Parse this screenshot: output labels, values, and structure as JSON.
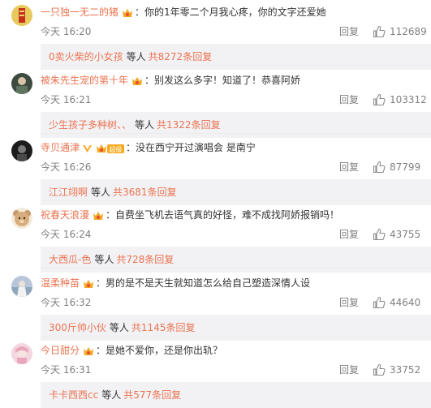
{
  "comments": [
    {
      "username": "一只独一无二的猪",
      "text": "你的1年零二个月我心疼，你的文字还爱她",
      "time": "今天 16:20",
      "reply_label": "回复",
      "likes": "112689",
      "reply_preview": {
        "name": "0卖火柴的小女孩",
        "suffix": "等人",
        "count": "共8272条回复"
      }
    },
    {
      "username": "被朱先生宠的第十年",
      "text": "别发这么多字！知道了！恭喜阿娇",
      "time": "今天 16:21",
      "reply_label": "回复",
      "likes": "103312",
      "reply_preview": {
        "name": "少生孩子多种树、、",
        "suffix": "等人",
        "count": "共1322条回复"
      }
    },
    {
      "username": "寺贝通津",
      "text": "没在西宁开过演唱会 是南宁",
      "time": "今天 16:26",
      "reply_label": "回复",
      "likes": "87799",
      "badge_text": "超级",
      "reply_preview": {
        "name": "江江翊啊",
        "suffix": "等人",
        "count": "共3681条回复"
      }
    },
    {
      "username": "祝春天浪漫",
      "text": "自费坐飞机去语气真的好怪，难不成找阿娇报销吗！",
      "time": "今天 16:24",
      "reply_label": "回复",
      "likes": "43755",
      "reply_preview": {
        "name": "大西瓜-色",
        "suffix": "等人",
        "count": "共728条回复"
      }
    },
    {
      "username": "温柔种苗",
      "text": "男的是不是天生就知道怎么给自己塑造深情人设",
      "time": "今天 16:32",
      "reply_label": "回复",
      "likes": "44640",
      "reply_preview": {
        "name": "300斤帅小伙",
        "suffix": "等人",
        "count": "共1145条回复"
      }
    },
    {
      "username": "今日甜分",
      "text": "是她不爱你，还是你出轨？",
      "time": "今天 16:31",
      "reply_label": "回复",
      "likes": "33752",
      "reply_preview": {
        "name": "卡卡西西cc",
        "suffix": "等人",
        "count": "共577条回复"
      }
    }
  ],
  "colors": {
    "username": "#eb7350",
    "text": "#333333",
    "meta": "#808080",
    "reply_bg": "#f2f2f5"
  },
  "icons": {
    "like": "thumbs-up-icon",
    "badge": "vip-badge-icon",
    "verified": "verified-v-icon"
  }
}
